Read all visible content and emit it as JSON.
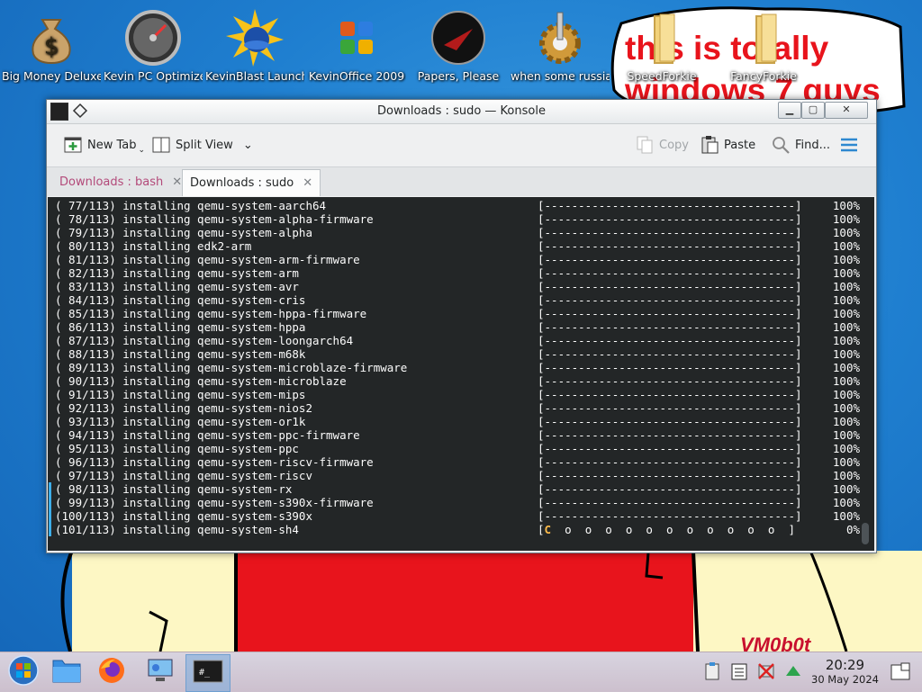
{
  "desktop": {
    "icons": [
      {
        "label": "Big Money Deluxe",
        "icon": "money-bag-icon"
      },
      {
        "label": "Kevin PC Optimizer Ho...",
        "icon": "speedometer-icon"
      },
      {
        "label": "KevinBlast Launcher",
        "icon": "sun-disc-icon"
      },
      {
        "label": "KevinOffice 2009",
        "icon": "office-logo-icon"
      },
      {
        "label": "Papers, Please",
        "icon": "papers-please-icon"
      },
      {
        "label": "when some russian runs a...",
        "icon": "gear-icon"
      },
      {
        "label": "SpeedForkie",
        "icon": "folder-icon"
      },
      {
        "label": "FancyForkie",
        "icon": "folder-icon"
      }
    ],
    "wallpaper_text": "this is totally windows 7 guys",
    "signature": "VM0b0t"
  },
  "window": {
    "title": "Downloads : sudo — Konsole",
    "toolbar": {
      "new_tab": "New Tab",
      "split_view": "Split View",
      "copy": "Copy",
      "paste": "Paste",
      "find": "Find..."
    },
    "tabs": [
      {
        "label": "Downloads : bash",
        "active": false
      },
      {
        "label": "Downloads : sudo",
        "active": true
      }
    ]
  },
  "terminal": {
    "lines": [
      {
        "n": "( 77/113)",
        "pkg": "qemu-system-aarch64",
        "bar": "[-------------------------------------]",
        "pct": "100%"
      },
      {
        "n": "( 78/113)",
        "pkg": "qemu-system-alpha-firmware",
        "bar": "[-------------------------------------]",
        "pct": "100%"
      },
      {
        "n": "( 79/113)",
        "pkg": "qemu-system-alpha",
        "bar": "[-------------------------------------]",
        "pct": "100%"
      },
      {
        "n": "( 80/113)",
        "pkg": "edk2-arm",
        "bar": "[-------------------------------------]",
        "pct": "100%"
      },
      {
        "n": "( 81/113)",
        "pkg": "qemu-system-arm-firmware",
        "bar": "[-------------------------------------]",
        "pct": "100%"
      },
      {
        "n": "( 82/113)",
        "pkg": "qemu-system-arm",
        "bar": "[-------------------------------------]",
        "pct": "100%"
      },
      {
        "n": "( 83/113)",
        "pkg": "qemu-system-avr",
        "bar": "[-------------------------------------]",
        "pct": "100%"
      },
      {
        "n": "( 84/113)",
        "pkg": "qemu-system-cris",
        "bar": "[-------------------------------------]",
        "pct": "100%"
      },
      {
        "n": "( 85/113)",
        "pkg": "qemu-system-hppa-firmware",
        "bar": "[-------------------------------------]",
        "pct": "100%"
      },
      {
        "n": "( 86/113)",
        "pkg": "qemu-system-hppa",
        "bar": "[-------------------------------------]",
        "pct": "100%"
      },
      {
        "n": "( 87/113)",
        "pkg": "qemu-system-loongarch64",
        "bar": "[-------------------------------------]",
        "pct": "100%"
      },
      {
        "n": "( 88/113)",
        "pkg": "qemu-system-m68k",
        "bar": "[-------------------------------------]",
        "pct": "100%"
      },
      {
        "n": "( 89/113)",
        "pkg": "qemu-system-microblaze-firmware",
        "bar": "[-------------------------------------]",
        "pct": "100%"
      },
      {
        "n": "( 90/113)",
        "pkg": "qemu-system-microblaze",
        "bar": "[-------------------------------------]",
        "pct": "100%"
      },
      {
        "n": "( 91/113)",
        "pkg": "qemu-system-mips",
        "bar": "[-------------------------------------]",
        "pct": "100%"
      },
      {
        "n": "( 92/113)",
        "pkg": "qemu-system-nios2",
        "bar": "[-------------------------------------]",
        "pct": "100%"
      },
      {
        "n": "( 93/113)",
        "pkg": "qemu-system-or1k",
        "bar": "[-------------------------------------]",
        "pct": "100%"
      },
      {
        "n": "( 94/113)",
        "pkg": "qemu-system-ppc-firmware",
        "bar": "[-------------------------------------]",
        "pct": "100%"
      },
      {
        "n": "( 95/113)",
        "pkg": "qemu-system-ppc",
        "bar": "[-------------------------------------]",
        "pct": "100%"
      },
      {
        "n": "( 96/113)",
        "pkg": "qemu-system-riscv-firmware",
        "bar": "[-------------------------------------]",
        "pct": "100%"
      },
      {
        "n": "( 97/113)",
        "pkg": "qemu-system-riscv",
        "bar": "[-------------------------------------]",
        "pct": "100%"
      },
      {
        "n": "( 98/113)",
        "pkg": "qemu-system-rx",
        "bar": "[-------------------------------------]",
        "pct": "100%"
      },
      {
        "n": "( 99/113)",
        "pkg": "qemu-system-s390x-firmware",
        "bar": "[-------------------------------------]",
        "pct": "100%"
      },
      {
        "n": "(100/113)",
        "pkg": "qemu-system-s390x",
        "bar": "[-------------------------------------]",
        "pct": "100%"
      },
      {
        "n": "(101/113)",
        "pkg": "qemu-system-sh4",
        "bar": "[C  o  o  o  o  o  o  o  o  o  o  o  ]",
        "pct": "0%"
      }
    ],
    "verb": "installing",
    "pacman_color": "#fdbc4b"
  },
  "taskbar": {
    "clock_time": "20:29",
    "clock_date": "30 May 2024",
    "buttons": [
      "start-orb-icon",
      "file-manager-icon",
      "firefox-icon",
      "system-settings-icon",
      "konsole-icon"
    ]
  },
  "colors": {
    "terminal_bg": "#232627",
    "terminal_fg": "#fcfcfc",
    "accent": "#3daee9",
    "wallpaper_red": "#e8141c",
    "wallpaper_skin": "#fdf7c4"
  }
}
